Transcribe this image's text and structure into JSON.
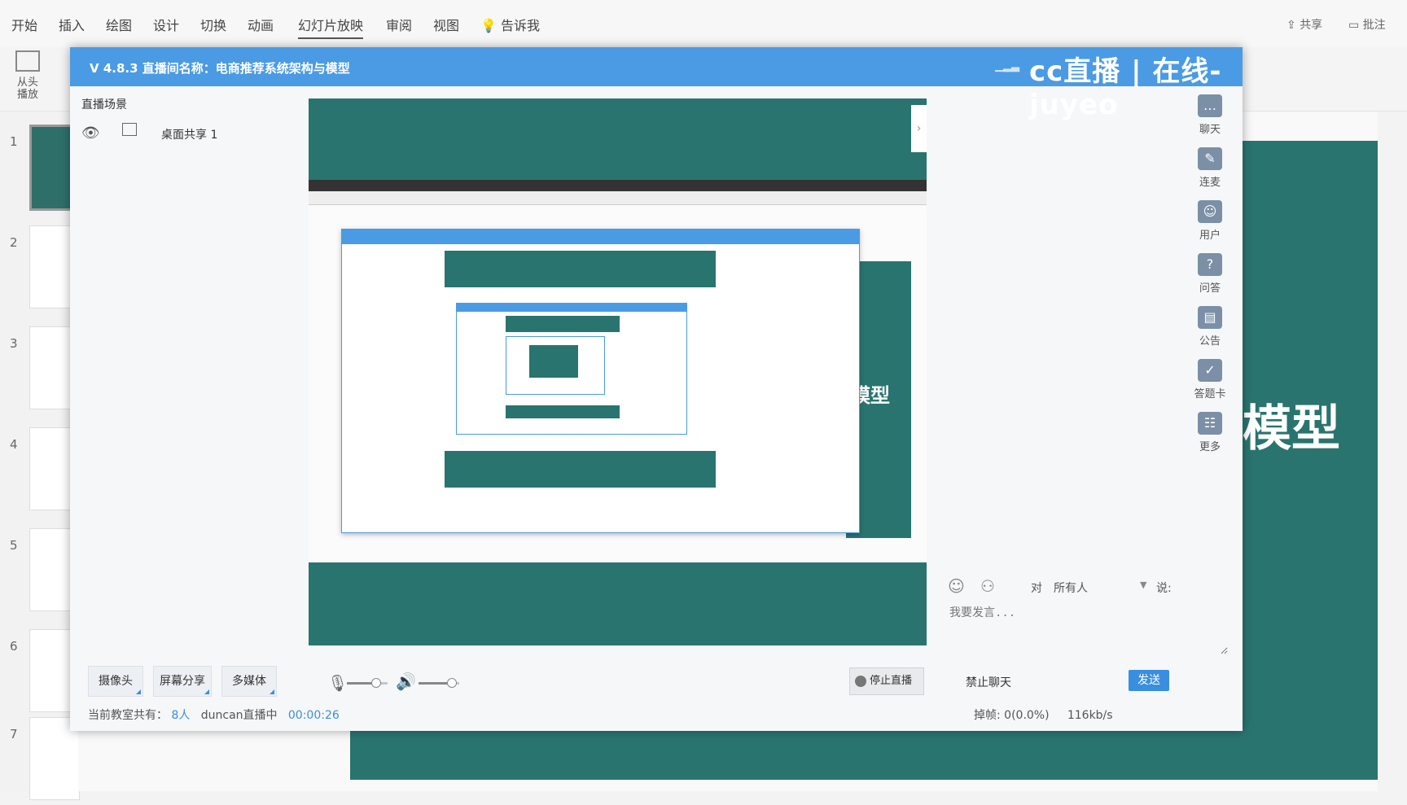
{
  "ppt": {
    "tabs": [
      "开始",
      "插入",
      "绘图",
      "设计",
      "切换",
      "动画",
      "幻灯片放映",
      "审阅",
      "视图",
      "告诉我"
    ],
    "active_tab": "幻灯片放映",
    "share": "共享",
    "comment": "批注",
    "play_from_start": "从头\n播放",
    "slide_numbers": [
      "1",
      "2",
      "3",
      "4",
      "5",
      "6",
      "7"
    ],
    "slide_big_text": "模型"
  },
  "live": {
    "title": "V 4.8.3   直播间名称：电商推荐系统架构与模型",
    "watermark": "cc直播 | 在线-juyeo",
    "scene_label": "直播场景",
    "scene_item": "桌面共享 1",
    "preview_slide_text": "模型",
    "side": [
      "聊天",
      "连麦",
      "用户",
      "问答",
      "公告",
      "答题卡",
      "更多"
    ],
    "chat": {
      "to": "对",
      "target": "所有人",
      "say": "说:",
      "placeholder": "我要发言...",
      "mute": "禁止聊天",
      "send": "发送"
    },
    "controls": {
      "camera": "摄像头",
      "screen": "屏幕分享",
      "media": "多媒体",
      "stop": "停止直播",
      "mic_level": 0.7,
      "speaker_level": 0.8
    },
    "status": {
      "prefix": "当前教室共有：",
      "count": "8人",
      "host": "duncan直播中",
      "time": "00:00:26",
      "drop": "掉帧: 0(0.0%)",
      "rate": "116kb/s"
    }
  }
}
